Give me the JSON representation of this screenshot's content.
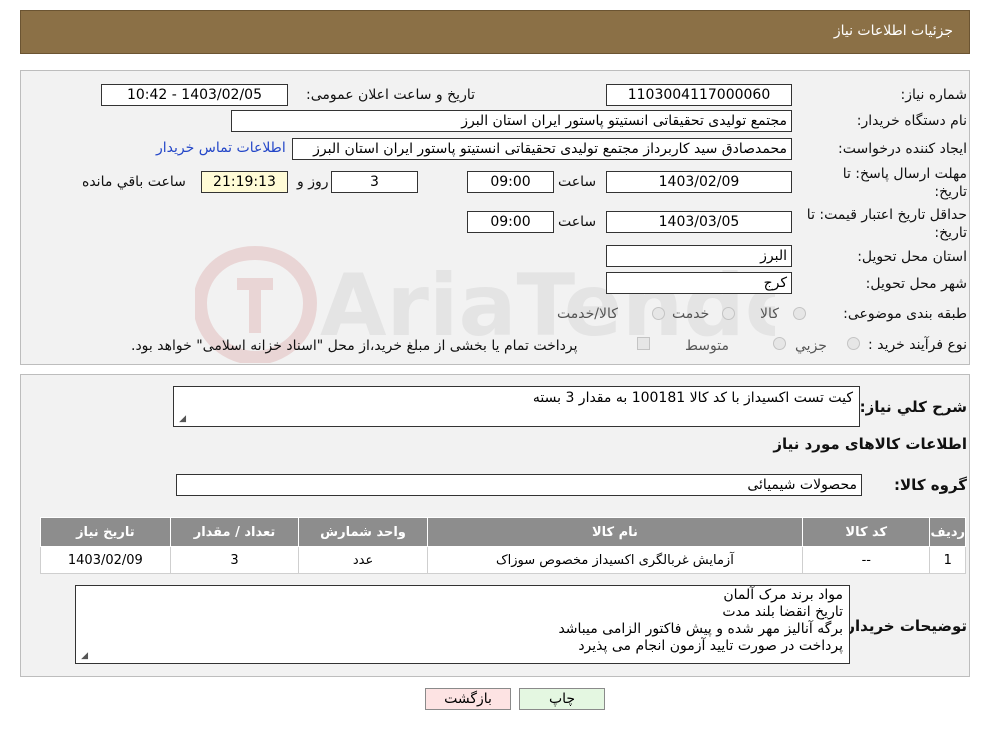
{
  "header": {
    "title": "جزئیات اطلاعات نیاز"
  },
  "fields": {
    "need_number_label": "شماره نیاز:",
    "need_number": "1103004117000060",
    "announce_label": "تاریخ و ساعت اعلان عمومی:",
    "announce_value": "1403/02/05 - 10:42",
    "buyer_org_label": "نام دستگاه خریدار:",
    "buyer_org": "مجتمع تولیدی تحقیقاتی انستیتو پاستور ایران استان البرز",
    "creator_label": "ایجاد کننده درخواست:",
    "creator": "محمدصادق سید کاربرداز مجتمع تولیدی تحقیقاتی انستیتو پاستور ایران استان البرز",
    "contact_link": "اطلاعات تماس خریدار",
    "deadline_label": "مهلت ارسال پاسخ: تا تاریخ:",
    "deadline_date": "1403/02/09",
    "time_label": "ساعت",
    "deadline_time": "09:00",
    "days_value": "3",
    "days_label": "روز و",
    "remaining_time": "21:19:13",
    "remaining_label": "ساعت باقي مانده",
    "validity_label": "حداقل تاریخ اعتبار قیمت: تا تاریخ:",
    "validity_date": "1403/03/05",
    "validity_time": "09:00",
    "province_label": "استان محل تحویل:",
    "province": "البرز",
    "city_label": "شهر محل تحویل:",
    "city": "کرج",
    "category_label": "طبقه بندی موضوعی:",
    "category_options": [
      "کالا",
      "خدمت",
      "کالا/خدمت"
    ],
    "process_label": "نوع فرآیند خرید :",
    "process_options": [
      "جزیي",
      "متوسط"
    ],
    "process_note": "پرداخت تمام یا بخشی از مبلغ خرید،از محل \"اسناد خزانه اسلامی\" خواهد بود."
  },
  "summary": {
    "desc_label": "شرح کلي نياز:",
    "desc_value": "کیت تست اکسیداز با کد کالا 100181 به مقدار 3 بسته",
    "items_title": "اطلاعات کالاهای مورد نياز",
    "group_label": "گروه کالا:",
    "group_value": "محصولات شیمیائی"
  },
  "table": {
    "headers": [
      "ردیف",
      "کد کالا",
      "نام کالا",
      "واحد شمارش",
      "تعداد / مقدار",
      "تاریخ نیاز"
    ],
    "rows": [
      [
        "1",
        "--",
        "آزمایش غربالگری اکسیداز مخصوص سوزاک",
        "عدد",
        "3",
        "1403/02/09"
      ]
    ]
  },
  "buyer_notes": {
    "label": "توضیحات خریدار:",
    "lines": [
      "مواد برند مرک آلمان",
      "تاریخ انقضا بلند مدت",
      "برگه آنالیز مهر شده و پیش فاکتور الزامی میباشد",
      "پرداخت در صورت تایید آزمون انجام می پذیرد"
    ]
  },
  "buttons": {
    "print": "چاپ",
    "back": "بازگشت"
  },
  "watermark": {
    "text": "AriaTender.neT"
  },
  "colors": {
    "header": "#8b7046",
    "link": "#2447c8",
    "table_header": "#8d8d8d",
    "yellow_field": "#fffbd6",
    "back_button": "#fde3e3",
    "print_button": "#e4f7e1"
  }
}
